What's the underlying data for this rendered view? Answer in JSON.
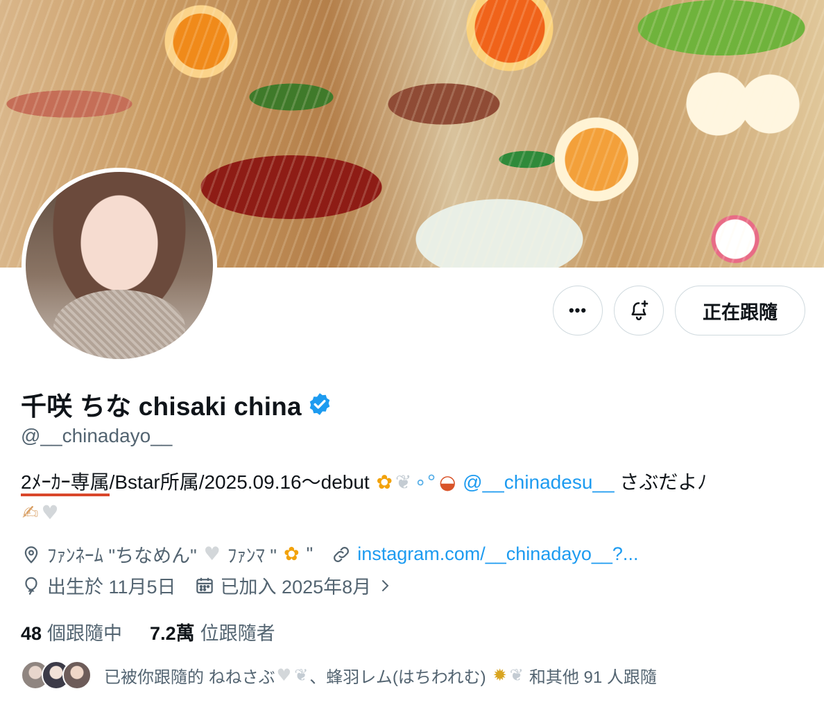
{
  "profile": {
    "display_name": "千咲 ちな chisaki china",
    "handle": "@__chinadayo__",
    "verified": true
  },
  "actions": {
    "more_label": "•••",
    "follow_label": "正在跟隨"
  },
  "bio": {
    "underlined_part": "2ﾒｰｶｰ専属",
    "text_part": "/Bstar所属/2025.09.16〜debut",
    "mention": "@__chinadesu__",
    "after_mention": "さぶだよ",
    "signature_glyph": "ﾉ"
  },
  "meta": {
    "location": "ﾌｧﾝﾈｰﾑ \"ちなめん\"",
    "location_part2": "ﾌｧﾝﾏ \"",
    "location_part3": "\"",
    "website": "instagram.com/__chinadayo__?...",
    "birthday": "出生於 11月5日",
    "joined": "已加入 2025年8月"
  },
  "stats": {
    "following_count": "48",
    "following_label": "個跟隨中",
    "followers_count": "7.2萬",
    "followers_label": "位跟隨者"
  },
  "followed_by": {
    "prefix": "已被你跟隨的 ねねさぶ",
    "middle": "、蜂羽レム(はちわれむ)",
    "suffix": "和其他 91 人跟隨"
  },
  "icons": {
    "more": "more-icon",
    "notify": "bell-plus-icon",
    "verified": "verified-badge-icon",
    "location": "location-pin-icon",
    "link": "link-icon",
    "birthday": "balloon-icon",
    "calendar": "calendar-icon"
  },
  "colors": {
    "accent": "#1d9bf0",
    "secondary_text": "#536471",
    "primary_text": "#0f1419",
    "underline": "#d9472b"
  }
}
